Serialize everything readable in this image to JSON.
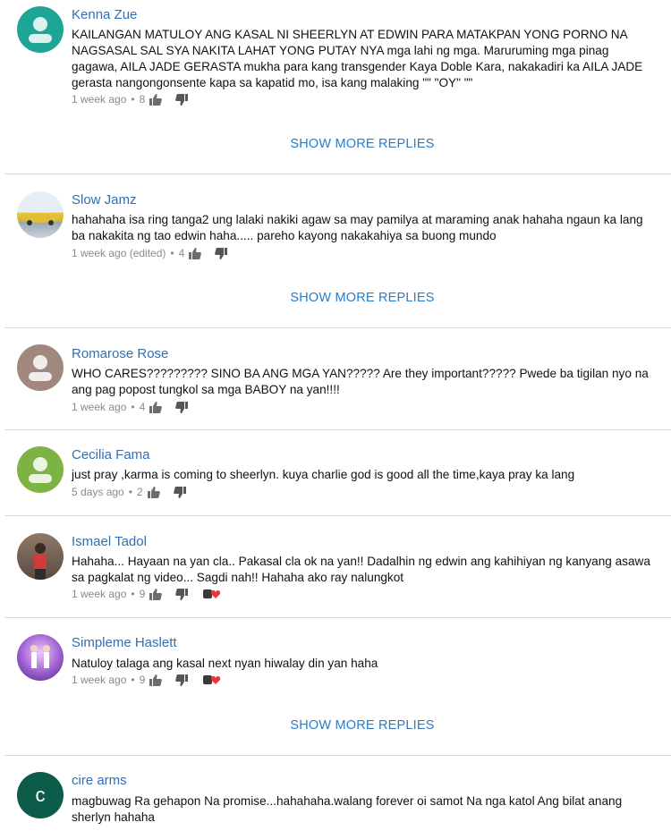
{
  "colors": {
    "link": "#2a7cc7",
    "author": "#2f6fb5",
    "meta": "#8a8a8a",
    "separator": "#d9d9d9"
  },
  "icons": {
    "like": "thumbs-up-icon",
    "dislike": "thumbs-down-icon",
    "heart": "heart-icon"
  },
  "show_more_label": "SHOW MORE REPLIES",
  "comments": [
    {
      "author": "Kenna Zue",
      "avatar_color": "#1fa596",
      "text": "KAILANGAN MATULOY ANG KASAL NI SHEERLYN AT EDWIN PARA MATAKPAN YONG PORNO NA NAGSASAL SAL SYA NAKITA LAHAT YONG PUTAY NYA mga lahi ng mga. Maruruming mga pinag gagawa, AILA JADE GERASTA mukha para kang transgender Kaya Doble Kara, nakakadiri ka AILA JADE gerasta nangongonsente kapa sa kapatid mo, isa kang malaking \"\" \"OY\" \"\"",
      "time": "1 week ago",
      "likes": "8"
    },
    {
      "author": "Slow Jamz",
      "avatar_color": "#e9c640",
      "text": "hahahaha isa ring tanga2 ung lalaki nakiki agaw sa may pamilya at maraming anak hahaha ngaun ka lang ba nakakita ng tao edwin haha..... pareho kayong nakakahiya sa buong mundo",
      "time": "1 week ago (edited)",
      "likes": "4"
    },
    {
      "author": "Romarose Rose",
      "avatar_color": "#a1887f",
      "text": "WHO CARES????????? SINO BA ANG MGA YAN????? Are they important????? Pwede ba tigilan nyo na ang pag popost tungkol sa mga BABOY na yan!!!!",
      "time": "1 week ago",
      "likes": "4"
    },
    {
      "author": "Cecilia Fama",
      "avatar_color": "#7cb342",
      "text": "just pray ,karma is coming to sheerlyn. kuya charlie god is good all the time,kaya pray ka lang",
      "time": "5 days ago",
      "likes": "2"
    },
    {
      "author": "Ismael Tadol",
      "avatar_color": "#6d5a4e",
      "text": "Hahaha... Hayaan na yan cla.. Pakasal cla ok na yan!! Dadalhin ng edwin ang kahihiyan ng kanyang asawa sa pagkalat ng video... Sagdi nah!! Hahaha ako ray nalungkot",
      "time": "1 week ago",
      "likes": "9"
    },
    {
      "author": "Simpleme Haslett",
      "avatar_color": "#7e57c2",
      "text": "Natuloy talaga ang kasal next nyan hiwalay din yan haha",
      "time": "1 week ago",
      "likes": "9"
    },
    {
      "author": "cire arms",
      "avatar_color": "#0d5c4a",
      "avatar_letter": "c",
      "text": "magbuwag Ra gehapon Na promise...hahahaha.walang forever oi samot Na nga katol Ang bilat anang sherlyn hahaha"
    }
  ]
}
